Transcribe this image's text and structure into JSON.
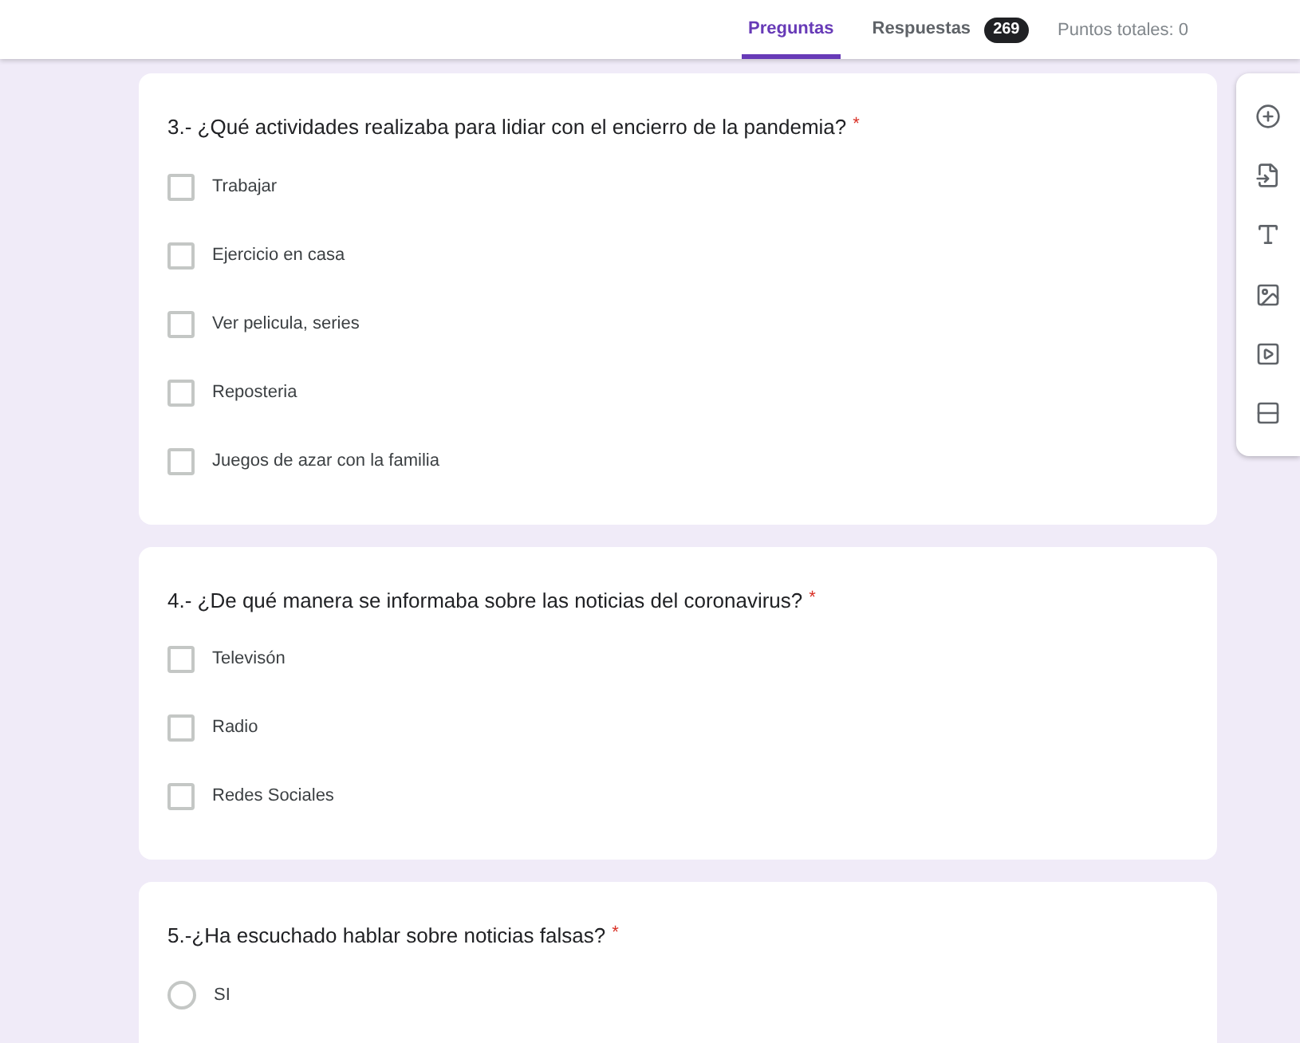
{
  "tabs": [
    {
      "label": "Preguntas",
      "selected": true
    },
    {
      "label": "Respuestas",
      "selected": false,
      "badge": "269"
    }
  ],
  "total_points": "Puntos totales: 0",
  "questions": [
    {
      "title": "3.- ¿Qué actividades realizaba para lidiar con el encierro de la pandemia?",
      "required": "*",
      "kind": "checkbox",
      "options": [
        {
          "label": "Trabajar",
          "checked": false
        },
        {
          "label": "Ejercicio en casa",
          "checked": false
        },
        {
          "label": "Ver pelicula, series",
          "checked": false
        },
        {
          "label": "Reposteria",
          "checked": false
        },
        {
          "label": "Juegos de azar con la familia",
          "checked": false
        }
      ]
    },
    {
      "title": "4.- ¿De qué manera se informaba sobre las noticias del coronavirus?",
      "required": "*",
      "kind": "checkbox",
      "options": [
        {
          "label": "Televisón",
          "checked": false
        },
        {
          "label": "Radio",
          "checked": false
        },
        {
          "label": "Redes Sociales",
          "checked": false
        }
      ]
    },
    {
      "title": "5.-¿Ha escuchado hablar sobre noticias falsas?",
      "required": "*",
      "kind": "radio",
      "options": [
        {
          "label": "SI",
          "selected": false
        }
      ]
    }
  ]
}
